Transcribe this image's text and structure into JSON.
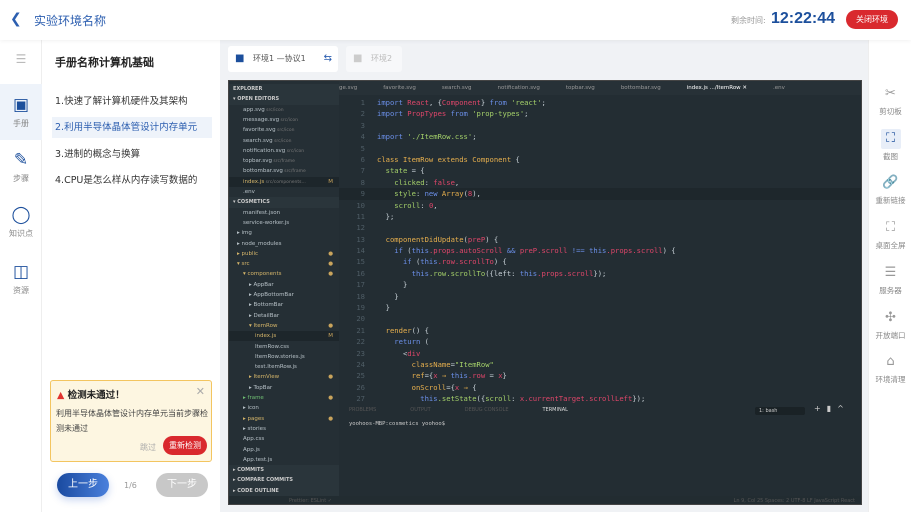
{
  "header": {
    "title": "实验环境名称",
    "remaining_label": "剩余时间:",
    "timer": "12:22:44",
    "close_button": "关闭环境"
  },
  "left_rail": [
    {
      "label": "手册",
      "icon": "manual-icon",
      "active": true
    },
    {
      "label": "步骤",
      "icon": "steps-icon"
    },
    {
      "label": "知识点",
      "icon": "knowledge-icon"
    },
    {
      "label": "资源",
      "icon": "resource-icon"
    }
  ],
  "manual": {
    "title": "手册名称计算机基础",
    "items": [
      "1.快速了解计算机硬件及其架构",
      "2.利用半导体晶体管设计内存单元",
      "3.进制的概念与换算",
      "4.CPU是怎么样从内存读写数据的"
    ],
    "active_index": 1
  },
  "alert": {
    "title": "检测未通过！",
    "message": "利用半导体晶体管设计内存单元当前步骤检测未通过",
    "skip": "跳过",
    "retry": "重新检测"
  },
  "pager": {
    "prev": "上一步",
    "page": "1/6",
    "next": "下一步"
  },
  "env_tabs": [
    {
      "label": "环境1 —协议1",
      "active": true
    },
    {
      "label": "环境2"
    }
  ],
  "editor": {
    "explorer": [
      {
        "t": "EXPLORER",
        "h": 1
      },
      {
        "t": "▾ OPEN EDITORS",
        "h": 1
      },
      {
        "t": "app.svg",
        "p": "src/icon",
        "i": 1
      },
      {
        "t": "message.svg",
        "p": "src/icon",
        "i": 1
      },
      {
        "t": "favorite.svg",
        "p": "src/icon",
        "i": 1
      },
      {
        "t": "search.svg",
        "p": "src/icon",
        "i": 1
      },
      {
        "t": "notification.svg",
        "p": "src/icon",
        "i": 1
      },
      {
        "t": "topbar.svg",
        "p": "src/frame",
        "i": 1
      },
      {
        "t": "bottombar.svg",
        "p": "src/frame",
        "i": 1
      },
      {
        "t": "index.js",
        "p": "src/components...",
        "i": 1,
        "m": "M",
        "sel": 1,
        "c": "y"
      },
      {
        "t": ".env",
        "i": 1
      },
      {
        "t": "▾ COSMETICS",
        "h": 1
      },
      {
        "t": "manifest.json",
        "i": 1
      },
      {
        "t": "service-worker.js",
        "i": 1
      },
      {
        "t": "▸ img",
        "i": 0
      },
      {
        "t": "▸ node_modules",
        "i": 0
      },
      {
        "t": "▸ public",
        "i": 0,
        "m": "●",
        "c": "y"
      },
      {
        "t": "▾ src",
        "i": 0,
        "m": "●",
        "c": "y"
      },
      {
        "t": "▾ components",
        "i": 1,
        "m": "●",
        "c": "y"
      },
      {
        "t": "▸ AppBar",
        "i": 2
      },
      {
        "t": "▸ AppBottomBar",
        "i": 2
      },
      {
        "t": "▸ BottomBar",
        "i": 2
      },
      {
        "t": "▸ DetailBar",
        "i": 2
      },
      {
        "t": "▾ ItemRow",
        "i": 2,
        "m": "●",
        "c": "y"
      },
      {
        "t": "index.js",
        "i": 3,
        "m": "M",
        "sel": 1,
        "c": "y"
      },
      {
        "t": "ItemRow.css",
        "i": 3
      },
      {
        "t": "ItemRow.stories.js",
        "i": 3
      },
      {
        "t": "test.ItemRow.js",
        "i": 3
      },
      {
        "t": "▸ ItemView",
        "i": 2,
        "m": "●",
        "c": "y"
      },
      {
        "t": "▸ TopBar",
        "i": 2
      },
      {
        "t": "▸ frame",
        "i": 1,
        "m": "●",
        "c": "g"
      },
      {
        "t": "▸ icon",
        "i": 1
      },
      {
        "t": "▸ pages",
        "i": 1,
        "m": "●",
        "c": "y"
      },
      {
        "t": "▸ stories",
        "i": 1
      },
      {
        "t": "App.css",
        "i": 1
      },
      {
        "t": "App.js",
        "i": 1
      },
      {
        "t": "App.test.js",
        "i": 1
      },
      {
        "t": "▸ COMMITS",
        "h": 1
      },
      {
        "t": "▸ COMPARE COMMITS",
        "h": 1
      },
      {
        "t": "▸ CODE OUTLINE",
        "h": 1
      }
    ],
    "file_tabs": [
      "ge.svg",
      "favorite.svg",
      "search.svg",
      "notification.svg",
      "topbar.svg",
      "bottombar.svg",
      "index.js .../ItemRow ✕",
      ".env"
    ],
    "code": [
      [
        [
          "import ",
          "k"
        ],
        [
          "React",
          "r"
        ],
        [
          ", {",
          "w"
        ],
        [
          "Component",
          "r"
        ],
        [
          "} ",
          "w"
        ],
        [
          "from ",
          "k"
        ],
        [
          "'react'",
          "s"
        ],
        [
          ";",
          "w"
        ]
      ],
      [
        [
          "import ",
          "k"
        ],
        [
          "PropTypes ",
          "r"
        ],
        [
          "from ",
          "k"
        ],
        [
          "'prop-types'",
          "s"
        ],
        [
          ";",
          "w"
        ]
      ],
      [],
      [
        [
          "import ",
          "k"
        ],
        [
          "'./ItemRow.css'",
          "s"
        ],
        [
          ";",
          "w"
        ]
      ],
      [],
      [
        [
          "class ",
          "c"
        ],
        [
          "ItemRow ",
          "c"
        ],
        [
          "extends ",
          "c"
        ],
        [
          "Component ",
          "c"
        ],
        [
          "{",
          "w"
        ]
      ],
      [
        [
          "  state ",
          "s"
        ],
        [
          "= {",
          "w"
        ]
      ],
      [
        [
          "    clicked",
          "s"
        ],
        [
          ": ",
          "w"
        ],
        [
          "false",
          "r"
        ],
        [
          ",",
          "w"
        ]
      ],
      [
        [
          "    style",
          "s"
        ],
        [
          ": ",
          "w"
        ],
        [
          "new ",
          "k"
        ],
        [
          "Array",
          "c"
        ],
        [
          "(",
          "w"
        ],
        [
          "8",
          "r"
        ],
        [
          "),",
          "w"
        ]
      ],
      [
        [
          "    scroll",
          "s"
        ],
        [
          ": ",
          "w"
        ],
        [
          "0",
          "r"
        ],
        [
          ",",
          "w"
        ]
      ],
      [
        [
          "  };",
          "w"
        ]
      ],
      [],
      [
        [
          "  componentDidUpdate",
          "c"
        ],
        [
          "(",
          "w"
        ],
        [
          "preP",
          "r"
        ],
        [
          ") {",
          "w"
        ]
      ],
      [
        [
          "    if ",
          "k"
        ],
        [
          "(",
          "w"
        ],
        [
          "this",
          "k"
        ],
        [
          ".props.autoScroll ",
          "r"
        ],
        [
          "&& ",
          "k"
        ],
        [
          "preP",
          "r"
        ],
        [
          ".scroll ",
          "r"
        ],
        [
          "!== ",
          "k"
        ],
        [
          "this",
          "k"
        ],
        [
          ".props.scroll",
          "r"
        ],
        [
          ") {",
          "w"
        ]
      ],
      [
        [
          "      if ",
          "k"
        ],
        [
          "(",
          "w"
        ],
        [
          "this",
          "k"
        ],
        [
          ".row.scrollTo",
          "r"
        ],
        [
          ") {",
          "w"
        ]
      ],
      [
        [
          "        this",
          "k"
        ],
        [
          ".row.scrollTo",
          "s"
        ],
        [
          "({left: ",
          "w"
        ],
        [
          "this",
          "k"
        ],
        [
          ".props.scroll",
          "r"
        ],
        [
          "});",
          "w"
        ]
      ],
      [
        [
          "      }",
          "w"
        ]
      ],
      [
        [
          "    }",
          "w"
        ]
      ],
      [
        [
          "  }",
          "w"
        ]
      ],
      [],
      [
        [
          "  render",
          "c"
        ],
        [
          "() {",
          "w"
        ]
      ],
      [
        [
          "    return ",
          "k"
        ],
        [
          "(",
          "w"
        ]
      ],
      [
        [
          "      <",
          "w"
        ],
        [
          "div",
          "r"
        ]
      ],
      [
        [
          "        className",
          "c"
        ],
        [
          "=",
          "w"
        ],
        [
          "\"ItemRow\"",
          "s"
        ]
      ],
      [
        [
          "        ref",
          "c"
        ],
        [
          "={",
          "w"
        ],
        [
          "x ",
          "r"
        ],
        [
          "⇒ ",
          "c"
        ],
        [
          "this",
          "k"
        ],
        [
          ".row ",
          "r"
        ],
        [
          "= ",
          "w"
        ],
        [
          "x",
          "r"
        ],
        [
          "}",
          "w"
        ]
      ],
      [
        [
          "        onScroll",
          "c"
        ],
        [
          "={",
          "w"
        ],
        [
          "x ",
          "r"
        ],
        [
          "⇒ ",
          "c"
        ],
        [
          "{",
          "w"
        ]
      ],
      [
        [
          "          this",
          "k"
        ],
        [
          ".setState",
          "s"
        ],
        [
          "({",
          "w"
        ],
        [
          "scroll",
          "s"
        ],
        [
          ": ",
          "w"
        ],
        [
          "x",
          "r"
        ],
        [
          ".currentTarget.scrollLeft",
          "r"
        ],
        [
          "});",
          "w"
        ]
      ]
    ],
    "current_line": 9,
    "panel_tabs": [
      "PROBLEMS",
      "OUTPUT",
      "DEBUG CONSOLE",
      "TERMINAL"
    ],
    "terminal_prompt": "yoohoos-MBP:cosmetics yoohoo$",
    "terminal_select": "1: bash",
    "status": "Ln 9, Col 25   Spaces: 2   UTF-8   LF   JavaScript React",
    "status_left": "Prettier: ESLint ✓"
  },
  "right_rail": [
    {
      "label": "剪切板",
      "icon": "scissors-icon"
    },
    {
      "label": "截图",
      "icon": "screenshot-icon",
      "active": true
    },
    {
      "label": "重新链接",
      "icon": "link-icon"
    },
    {
      "label": "桌面全屏",
      "icon": "fullscreen-icon"
    },
    {
      "label": "服务器",
      "icon": "server-icon"
    },
    {
      "label": "开放端口",
      "icon": "port-icon"
    },
    {
      "label": "环境清理",
      "icon": "clean-icon"
    }
  ]
}
